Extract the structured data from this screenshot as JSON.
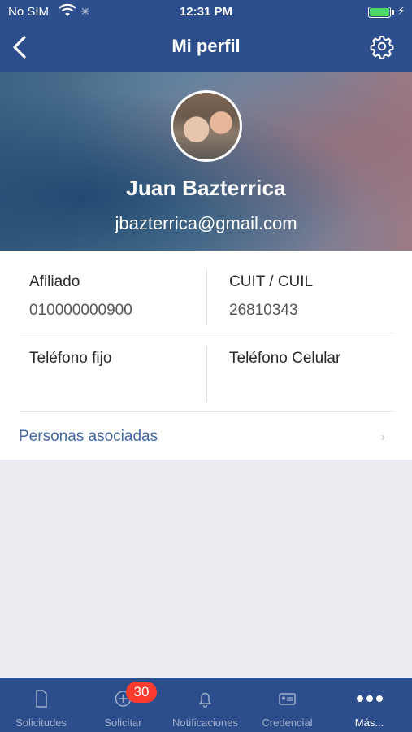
{
  "status_bar": {
    "carrier": "No SIM",
    "time": "12:31 PM"
  },
  "nav": {
    "title": "Mi perfil",
    "icons": [
      "chevron-left-icon",
      "gear-icon"
    ]
  },
  "profile": {
    "name": "Juan Bazterrica",
    "email": "jbazterrica@gmail.com"
  },
  "fields": {
    "afiliado_label": "Afiliado",
    "afiliado_value": "010000000900",
    "cuit_label": "CUIT / CUIL",
    "cuit_value": "26810343",
    "tel_fijo_label": "Teléfono fijo",
    "tel_fijo_value": "",
    "tel_celular_label": "Teléfono Celular",
    "tel_celular_value": ""
  },
  "associated": {
    "label": "Personas asociadas"
  },
  "tabbar": {
    "tabs": [
      {
        "label": "Solicitudes",
        "icon": "document-icon"
      },
      {
        "label": "Solicitar",
        "icon": "plus-circle-icon"
      },
      {
        "label": "Notificaciones",
        "icon": "bell-icon"
      },
      {
        "label": "Credencial",
        "icon": "id-card-icon"
      },
      {
        "label": "Más...",
        "icon": "more-dots-icon"
      }
    ],
    "active_index": 4,
    "badge": "30"
  },
  "colors": {
    "primary": "#2d4e8c",
    "link": "#45689f",
    "badge": "#ff3b30",
    "background": "#edecf2"
  }
}
